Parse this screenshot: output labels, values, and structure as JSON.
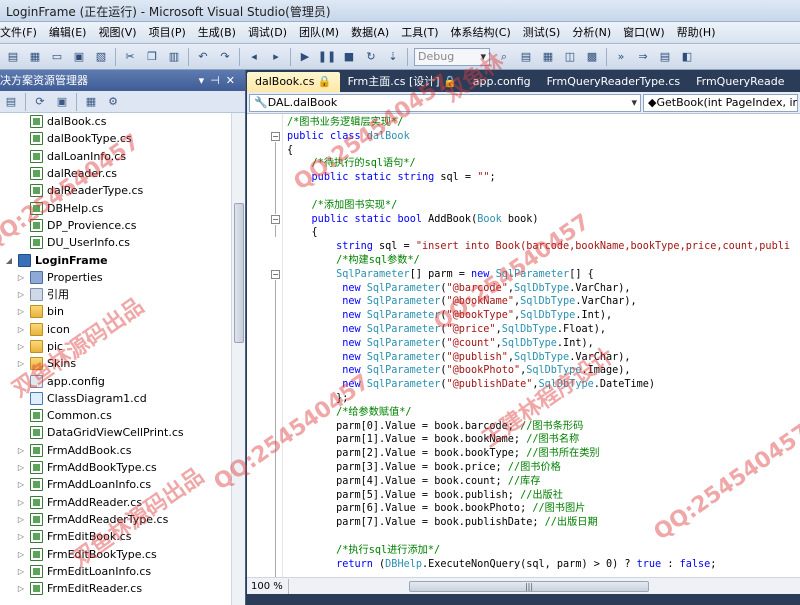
{
  "window": {
    "title": "LoginFrame (正在运行) - Microsoft Visual Studio(管理员)"
  },
  "menu": [
    "文件(F)",
    "编辑(E)",
    "视图(V)",
    "项目(P)",
    "生成(B)",
    "调试(D)",
    "团队(M)",
    "数据(A)",
    "工具(T)",
    "体系结构(C)",
    "测试(S)",
    "分析(N)",
    "窗口(W)",
    "帮助(H)"
  ],
  "toolbar": {
    "config_combo": "Debug"
  },
  "solution_explorer": {
    "title": "决方案资源管理器",
    "items": [
      {
        "label": "dalBook.cs",
        "icon": "cs-file-icon",
        "indent": 30,
        "expand": "",
        "bold": false
      },
      {
        "label": "dalBookType.cs",
        "icon": "cs-file-icon",
        "indent": 30,
        "expand": "",
        "bold": false
      },
      {
        "label": "dalLoanInfo.cs",
        "icon": "cs-file-icon",
        "indent": 30,
        "expand": "",
        "bold": false
      },
      {
        "label": "dalReader.cs",
        "icon": "cs-file-icon",
        "indent": 30,
        "expand": "",
        "bold": false
      },
      {
        "label": "dalReaderType.cs",
        "icon": "cs-file-icon",
        "indent": 30,
        "expand": "",
        "bold": false
      },
      {
        "label": "DBHelp.cs",
        "icon": "cs-file-icon",
        "indent": 30,
        "expand": "",
        "bold": false
      },
      {
        "label": "DP_Provience.cs",
        "icon": "cs-file-icon",
        "indent": 30,
        "expand": "",
        "bold": false
      },
      {
        "label": "DU_UserInfo.cs",
        "icon": "cs-file-icon",
        "indent": 30,
        "expand": "",
        "bold": false
      },
      {
        "label": "LoginFrame",
        "icon": "project-icon",
        "indent": 4,
        "expand": "◢",
        "bold": true
      },
      {
        "label": "Properties",
        "icon": "properties-icon",
        "indent": 16,
        "expand": "▷",
        "bold": false
      },
      {
        "label": "引用",
        "icon": "references-icon",
        "indent": 16,
        "expand": "▷",
        "bold": false
      },
      {
        "label": "bin",
        "icon": "folder-icon",
        "indent": 16,
        "expand": "▷",
        "bold": false
      },
      {
        "label": "icon",
        "icon": "folder-icon",
        "indent": 16,
        "expand": "▷",
        "bold": false
      },
      {
        "label": "pic",
        "icon": "folder-icon",
        "indent": 16,
        "expand": "▷",
        "bold": false
      },
      {
        "label": "Skins",
        "icon": "folder-icon",
        "indent": 16,
        "expand": "▷",
        "bold": false
      },
      {
        "label": "app.config",
        "icon": "config-file-icon",
        "indent": 30,
        "expand": "",
        "bold": false
      },
      {
        "label": "ClassDiagram1.cd",
        "icon": "class-diagram-icon",
        "indent": 30,
        "expand": "",
        "bold": false
      },
      {
        "label": "Common.cs",
        "icon": "cs-file-icon",
        "indent": 30,
        "expand": "",
        "bold": false
      },
      {
        "label": "DataGridViewCellPrint.cs",
        "icon": "cs-file-icon",
        "indent": 30,
        "expand": "",
        "bold": false
      },
      {
        "label": "FrmAddBook.cs",
        "icon": "cs-file-icon",
        "indent": 16,
        "expand": "▷",
        "bold": false
      },
      {
        "label": "FrmAddBookType.cs",
        "icon": "cs-file-icon",
        "indent": 16,
        "expand": "▷",
        "bold": false
      },
      {
        "label": "FrmAddLoanInfo.cs",
        "icon": "cs-file-icon",
        "indent": 16,
        "expand": "▷",
        "bold": false
      },
      {
        "label": "FrmAddReader.cs",
        "icon": "cs-file-icon",
        "indent": 16,
        "expand": "▷",
        "bold": false
      },
      {
        "label": "FrmAddReaderType.cs",
        "icon": "cs-file-icon",
        "indent": 16,
        "expand": "▷",
        "bold": false
      },
      {
        "label": "FrmEditBook.cs",
        "icon": "cs-file-icon",
        "indent": 16,
        "expand": "▷",
        "bold": false
      },
      {
        "label": "FrmEditBookType.cs",
        "icon": "cs-file-icon",
        "indent": 16,
        "expand": "▷",
        "bold": false
      },
      {
        "label": "FrmEditLoanInfo.cs",
        "icon": "cs-file-icon",
        "indent": 16,
        "expand": "▷",
        "bold": false
      },
      {
        "label": "FrmEditReader.cs",
        "icon": "cs-file-icon",
        "indent": 16,
        "expand": "▷",
        "bold": false
      }
    ]
  },
  "editor": {
    "tabs": [
      {
        "label": "dalBook.cs 🔒",
        "active": true
      },
      {
        "label": "Frm主面.cs [设计] 🔒",
        "active": false
      },
      {
        "label": "app.config",
        "active": false
      },
      {
        "label": "FrmQueryReaderType.cs",
        "active": false
      },
      {
        "label": "FrmQueryReade",
        "active": false
      }
    ],
    "class_combo": "🔧DAL.dalBook",
    "member_combo": "◆GetBook(int PageIndex, int P",
    "zoom": "100 %",
    "code_lines": [
      [
        [
          "cm",
          "/*图书业务逻辑层实现*/"
        ]
      ],
      [
        [
          "kw",
          "public"
        ],
        [
          "",
          " "
        ],
        [
          "kw",
          "class"
        ],
        [
          "",
          " "
        ],
        [
          "ty",
          "dalBook"
        ]
      ],
      [
        [
          "",
          "{"
        ]
      ],
      [
        [
          "",
          "    "
        ],
        [
          "cm",
          "/*待执行的sql语句*/"
        ]
      ],
      [
        [
          "",
          "    "
        ],
        [
          "kw",
          "public"
        ],
        [
          "",
          " "
        ],
        [
          "kw",
          "static"
        ],
        [
          "",
          " "
        ],
        [
          "kw",
          "string"
        ],
        [
          "",
          " sql = "
        ],
        [
          "st",
          "\"\""
        ],
        [
          "",
          ";"
        ]
      ],
      [
        [
          "",
          ""
        ]
      ],
      [
        [
          "",
          "    "
        ],
        [
          "cm",
          "/*添加图书实现*/"
        ]
      ],
      [
        [
          "",
          "    "
        ],
        [
          "kw",
          "public"
        ],
        [
          "",
          " "
        ],
        [
          "kw",
          "static"
        ],
        [
          "",
          " "
        ],
        [
          "kw",
          "bool"
        ],
        [
          "",
          " AddBook("
        ],
        [
          "ty",
          "Book"
        ],
        [
          "",
          " book)"
        ]
      ],
      [
        [
          "",
          "    {"
        ]
      ],
      [
        [
          "",
          "        "
        ],
        [
          "kw",
          "string"
        ],
        [
          "",
          " sql = "
        ],
        [
          "st",
          "\"insert into Book(barcode,bookName,bookType,price,count,publi"
        ]
      ],
      [
        [
          "",
          "        "
        ],
        [
          "cm",
          "/*构建sql参数*/"
        ]
      ],
      [
        [
          "",
          "        "
        ],
        [
          "ty",
          "SqlParameter"
        ],
        [
          "",
          "[] parm = "
        ],
        [
          "kw",
          "new"
        ],
        [
          "",
          " "
        ],
        [
          "ty",
          "SqlParameter"
        ],
        [
          "",
          "[] {"
        ]
      ],
      [
        [
          "",
          "         "
        ],
        [
          "kw",
          "new"
        ],
        [
          "",
          " "
        ],
        [
          "ty",
          "SqlParameter"
        ],
        [
          "",
          "("
        ],
        [
          "st",
          "\"@barcode\""
        ],
        [
          "",
          ","
        ],
        [
          "ty",
          "SqlDbType"
        ],
        [
          "",
          ".VarChar),"
        ]
      ],
      [
        [
          "",
          "         "
        ],
        [
          "kw",
          "new"
        ],
        [
          "",
          " "
        ],
        [
          "ty",
          "SqlParameter"
        ],
        [
          "",
          "("
        ],
        [
          "st",
          "\"@bookName\""
        ],
        [
          "",
          ","
        ],
        [
          "ty",
          "SqlDbType"
        ],
        [
          "",
          ".VarChar),"
        ]
      ],
      [
        [
          "",
          "         "
        ],
        [
          "kw",
          "new"
        ],
        [
          "",
          " "
        ],
        [
          "ty",
          "SqlParameter"
        ],
        [
          "",
          "("
        ],
        [
          "st",
          "\"@bookType\""
        ],
        [
          "",
          ","
        ],
        [
          "ty",
          "SqlDbType"
        ],
        [
          "",
          ".Int),"
        ]
      ],
      [
        [
          "",
          "         "
        ],
        [
          "kw",
          "new"
        ],
        [
          "",
          " "
        ],
        [
          "ty",
          "SqlParameter"
        ],
        [
          "",
          "("
        ],
        [
          "st",
          "\"@price\""
        ],
        [
          "",
          ","
        ],
        [
          "ty",
          "SqlDbType"
        ],
        [
          "",
          ".Float),"
        ]
      ],
      [
        [
          "",
          "         "
        ],
        [
          "kw",
          "new"
        ],
        [
          "",
          " "
        ],
        [
          "ty",
          "SqlParameter"
        ],
        [
          "",
          "("
        ],
        [
          "st",
          "\"@count\""
        ],
        [
          "",
          ","
        ],
        [
          "ty",
          "SqlDbType"
        ],
        [
          "",
          ".Int),"
        ]
      ],
      [
        [
          "",
          "         "
        ],
        [
          "kw",
          "new"
        ],
        [
          "",
          " "
        ],
        [
          "ty",
          "SqlParameter"
        ],
        [
          "",
          "("
        ],
        [
          "st",
          "\"@publish\""
        ],
        [
          "",
          ","
        ],
        [
          "ty",
          "SqlDbType"
        ],
        [
          "",
          ".VarChar),"
        ]
      ],
      [
        [
          "",
          "         "
        ],
        [
          "kw",
          "new"
        ],
        [
          "",
          " "
        ],
        [
          "ty",
          "SqlParameter"
        ],
        [
          "",
          "("
        ],
        [
          "st",
          "\"@bookPhoto\""
        ],
        [
          "",
          ","
        ],
        [
          "ty",
          "SqlDbType"
        ],
        [
          "",
          ".Image),"
        ]
      ],
      [
        [
          "",
          "         "
        ],
        [
          "kw",
          "new"
        ],
        [
          "",
          " "
        ],
        [
          "ty",
          "SqlParameter"
        ],
        [
          "",
          "("
        ],
        [
          "st",
          "\"@publishDate\""
        ],
        [
          "",
          ","
        ],
        [
          "ty",
          "SqlDbType"
        ],
        [
          "",
          ".DateTime)"
        ]
      ],
      [
        [
          "",
          "        };"
        ]
      ],
      [
        [
          "",
          "        "
        ],
        [
          "cm",
          "/*给参数赋值*/"
        ]
      ],
      [
        [
          "",
          "        parm[0].Value = book.barcode; "
        ],
        [
          "cm",
          "//图书条形码"
        ]
      ],
      [
        [
          "",
          "        parm[1].Value = book.bookName; "
        ],
        [
          "cm",
          "//图书名称"
        ]
      ],
      [
        [
          "",
          "        parm[2].Value = book.bookType; "
        ],
        [
          "cm",
          "//图书所在类别"
        ]
      ],
      [
        [
          "",
          "        parm[3].Value = book.price; "
        ],
        [
          "cm",
          "//图书价格"
        ]
      ],
      [
        [
          "",
          "        parm[4].Value = book.count; "
        ],
        [
          "cm",
          "//库存"
        ]
      ],
      [
        [
          "",
          "        parm[5].Value = book.publish; "
        ],
        [
          "cm",
          "//出版社"
        ]
      ],
      [
        [
          "",
          "        parm[6].Value = book.bookPhoto; "
        ],
        [
          "cm",
          "//图书图片"
        ]
      ],
      [
        [
          "",
          "        parm[7].Value = book.publishDate; "
        ],
        [
          "cm",
          "//出版日期"
        ]
      ],
      [
        [
          "",
          ""
        ]
      ],
      [
        [
          "",
          "        "
        ],
        [
          "cm",
          "/*执行sql进行添加*/"
        ]
      ],
      [
        [
          "",
          "        "
        ],
        [
          "kw",
          "return"
        ],
        [
          "",
          " ("
        ],
        [
          "ty",
          "DBHelp"
        ],
        [
          "",
          ".ExecuteNonQuery(sql, parm) > 0) ? "
        ],
        [
          "kw",
          "true"
        ],
        [
          "",
          " : "
        ],
        [
          "kw",
          "false"
        ],
        [
          "",
          ";"
        ]
      ]
    ]
  },
  "watermarks": [
    "QQ:254540457",
    "双鱼林源码出品",
    "王建林程序设计",
    "双鱼林"
  ],
  "colors": {
    "keyword": "#0000ff",
    "comment": "#008000",
    "type": "#2b91af",
    "string": "#a31515",
    "tab_active": "#ffe8a6",
    "frame": "#2b3c59",
    "watermark": "#dc3c3c"
  }
}
